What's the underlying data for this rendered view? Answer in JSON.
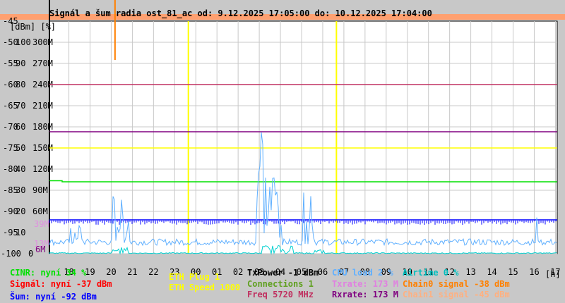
{
  "chart_data": {
    "type": "line",
    "title": "Signál a šum radia ost_81_ac od: 9.12.2025 17:05:00 do: 10.12.2025 17:04:00",
    "units_label": "[dBm] [%]",
    "x_unit": "[h]",
    "x_ticks": [
      "18",
      "19",
      "20",
      "21",
      "22",
      "23",
      "00",
      "01",
      "02",
      "03",
      "04",
      "05",
      "06",
      "07",
      "08",
      "09",
      "10",
      "11",
      "12",
      "13",
      "14",
      "15",
      "16",
      "17"
    ],
    "y_ticks_dbm": [
      "-45",
      "-50",
      "-55",
      "-60",
      "-65",
      "-70",
      "-75",
      "-80",
      "-85",
      "-90",
      "-95",
      "-100"
    ],
    "y_ticks_pct": [
      "100",
      "90",
      "80",
      "70",
      "60",
      "50",
      "40",
      "30",
      "20",
      "10",
      "0"
    ],
    "y_ticks_rate": [
      "300M",
      "270M",
      "240M",
      "210M",
      "180M",
      "150M",
      "120M",
      "90M",
      "60M"
    ],
    "extra_rate_labels": [
      {
        "text": "39M",
        "color": "#e090e0"
      },
      {
        "text": "13M",
        "color": "#e090e0"
      },
      {
        "text": "6M",
        "color": "#800080"
      }
    ],
    "ylim_dbm": [
      -100,
      -45
    ],
    "event_markers_hours": [
      6.0,
      13.0
    ],
    "series": [
      {
        "name": "CINR",
        "unit": "%",
        "color": "#00e000",
        "points": [
          [
            0,
            34.5
          ],
          [
            0.5,
            34.5
          ],
          [
            0.6,
            34
          ],
          [
            24,
            34
          ]
        ]
      },
      {
        "name": "Šum",
        "unit": "dBm",
        "color": "#0000ff",
        "points": [
          [
            0,
            -92
          ],
          [
            24,
            -92
          ]
        ]
      },
      {
        "name": "Freq",
        "unit": "M",
        "color": "#c03060",
        "points": [
          [
            0,
            240
          ],
          [
            24,
            240
          ]
        ]
      },
      {
        "name": "Rxrate",
        "unit": "M",
        "color": "#800080",
        "points": [
          [
            0,
            173
          ],
          [
            24,
            173
          ]
        ]
      },
      {
        "name": "ETH Speed",
        "unit": "M",
        "color": "#ffff00",
        "points": [
          [
            0,
            150
          ],
          [
            24,
            150
          ]
        ]
      },
      {
        "name": "CPU load",
        "unit": "%",
        "color": "#60b0ff",
        "bursts": [
          [
            3.0,
            3.3,
            25
          ],
          [
            3.3,
            3.8,
            22
          ],
          [
            9.8,
            10.2,
            68
          ],
          [
            10.2,
            11.0,
            40
          ],
          [
            12.0,
            12.5,
            38
          ],
          [
            1.0,
            1.6,
            10
          ],
          [
            23.0,
            23.2,
            15
          ]
        ],
        "baseline": 4
      },
      {
        "name": "Airtime",
        "unit": "%",
        "color": "#00d0d0",
        "bursts": [
          [
            3.0,
            3.8,
            3
          ],
          [
            10.0,
            11.5,
            4
          ],
          [
            12.5,
            13.0,
            2
          ]
        ],
        "baseline": 0
      }
    ]
  },
  "legend": {
    "cinr": "CINR: nyní 34 %",
    "signal": "Signál: nyní -37 dBm",
    "noise": "Šum: nyní -92 dBm",
    "eth_plug": "ETH Plug 1",
    "eth_speed": "ETH Speed 1000",
    "txpower": "TxPower -1 dBm",
    "connections": "Connections 1",
    "freq": "Freq 5720 MHz",
    "cpu": "CPU load 2 %",
    "txrate": "Txrate: 173 M",
    "rxrate": "Rxrate: 173 M",
    "airtime": "Airtime 0 %",
    "chain0": "Chain0 signal -38 dBm",
    "chain1": "Chain1 signal -45 dBm"
  },
  "colors": {
    "cinr": "#00e000",
    "signal": "#ff0000",
    "noise": "#0000ff",
    "eth": "#ffff00",
    "txpower": "#000000",
    "connections": "#60a020",
    "freq": "#c03060",
    "cpu": "#60b0ff",
    "txrate": "#e080e0",
    "rxrate": "#800080",
    "airtime": "#00c0c0",
    "chain0": "#ff8000",
    "chain1": "#ffb080"
  }
}
